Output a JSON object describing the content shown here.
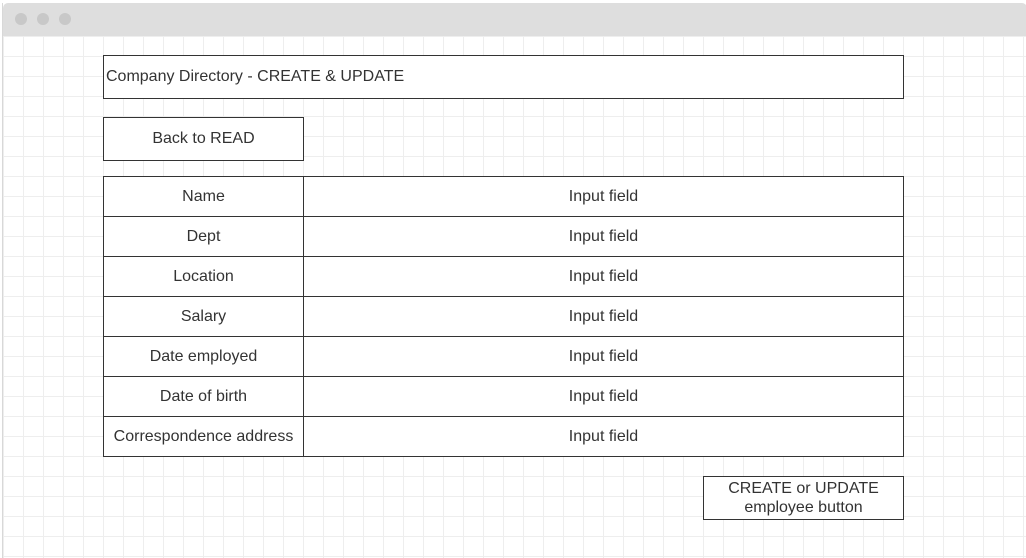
{
  "page": {
    "title": "Company Directory - CREATE & UPDATE",
    "back_button_label": "Back to READ",
    "submit_button_label": "CREATE or UPDATE employee button"
  },
  "form": {
    "rows": [
      {
        "label": "Name",
        "field": "Input field"
      },
      {
        "label": "Dept",
        "field": "Input field"
      },
      {
        "label": "Location",
        "field": "Input field"
      },
      {
        "label": "Salary",
        "field": "Input field"
      },
      {
        "label": "Date employed",
        "field": "Input field"
      },
      {
        "label": "Date of birth",
        "field": "Input field"
      },
      {
        "label": "Correspondence address",
        "field": "Input field"
      }
    ]
  },
  "colors": {
    "border": "#333333",
    "text": "#333333",
    "titlebar": "#dedede",
    "grid": "#eeeeee"
  },
  "icons": [
    "window-close-dot-icon",
    "window-minimize-dot-icon",
    "window-maximize-dot-icon"
  ]
}
